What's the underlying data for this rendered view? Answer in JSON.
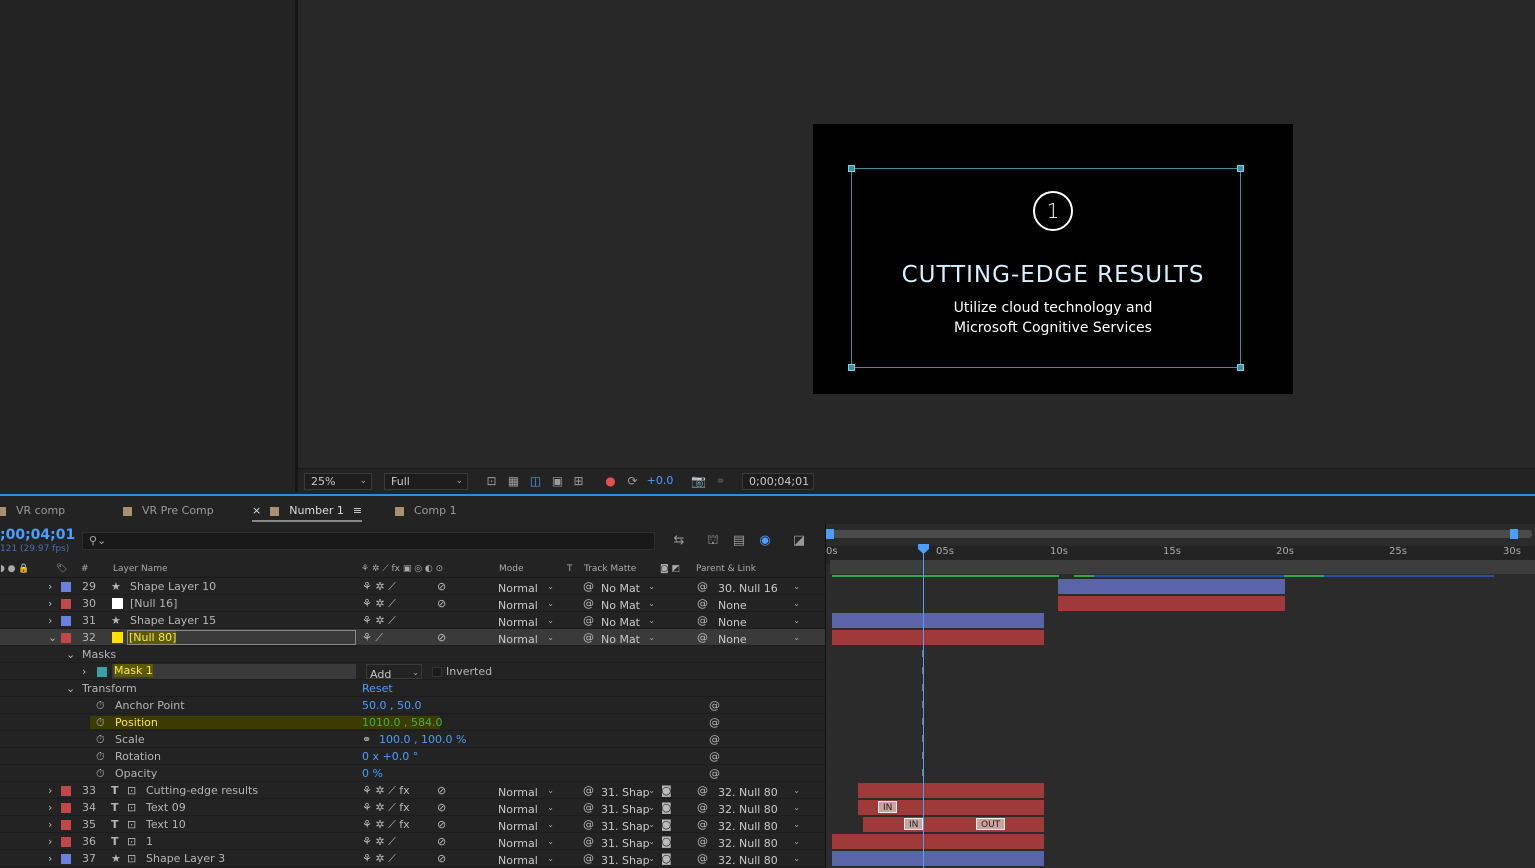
{
  "viewer": {
    "zoom": "25%",
    "resolution": "Full",
    "exposure": "+0.0",
    "timecode": "0;00;04;01"
  },
  "composition_preview": {
    "number": "1",
    "headline": "CUTTING-EDGE RESULTS",
    "sub_line1": "Utilize cloud technology and",
    "sub_line2": "Microsoft Cognitive Services"
  },
  "tabs": [
    {
      "label": "VR comp"
    },
    {
      "label": "VR Pre Comp"
    },
    {
      "label": "Number 1",
      "active": true
    },
    {
      "label": "Comp 1"
    }
  ],
  "timeline": {
    "timecode": ";00;04;01",
    "fps": "121 (29.97 fps)",
    "search_placeholder": "",
    "columns": {
      "num": "#",
      "layer_name": "Layer Name",
      "mode": "Mode",
      "t": "T",
      "track_matte": "Track Matte",
      "parent": "Parent & Link"
    },
    "ruler": [
      "0s",
      "05s",
      "10s",
      "15s",
      "20s",
      "25s",
      "30s"
    ],
    "layers_top": [
      {
        "num": "29",
        "name": "Shape Layer 10",
        "type": "star",
        "color": "#6b7fdc",
        "mode": "Normal",
        "matte": "No Mat",
        "parent": "30. Null 16"
      },
      {
        "num": "30",
        "name": "[Null 16]",
        "type": "null",
        "color": "#c04848",
        "mode": "Normal",
        "matte": "No Mat",
        "parent": "None"
      },
      {
        "num": "31",
        "name": "Shape Layer 15",
        "type": "star",
        "color": "#6b7fdc",
        "mode": "Normal",
        "matte": "No Mat",
        "parent": "None"
      },
      {
        "num": "32",
        "name": "[Null 80]",
        "type": "null-yellow",
        "color": "#c04848",
        "mode": "Normal",
        "matte": "No Mat",
        "parent": "None"
      }
    ],
    "masks_label": "Masks",
    "mask1": {
      "name": "Mask 1",
      "mode": "Add",
      "inverted": "Inverted"
    },
    "transform_label": "Transform",
    "reset_label": "Reset",
    "properties": [
      {
        "name": "Anchor Point",
        "value": "50.0 , 50.0"
      },
      {
        "name": "Position",
        "value": "1010.0 , 584.0"
      },
      {
        "name": "Scale",
        "value": "100.0 , 100.0 %"
      },
      {
        "name": "Rotation",
        "value": "0 x +0.0 °"
      },
      {
        "name": "Opacity",
        "value": "0 %"
      }
    ],
    "layers_bottom": [
      {
        "num": "33",
        "name": "Cutting-edge results",
        "type": "T",
        "color": "#c04848",
        "mode": "Normal",
        "matte": "31. Shap",
        "parent": "32. Null 80"
      },
      {
        "num": "34",
        "name": "Text 09",
        "type": "T",
        "color": "#c04848",
        "mode": "Normal",
        "matte": "31. Shap",
        "parent": "32. Null 80"
      },
      {
        "num": "35",
        "name": "Text 10",
        "type": "T",
        "color": "#c04848",
        "mode": "Normal",
        "matte": "31. Shap",
        "parent": "32. Null 80"
      },
      {
        "num": "36",
        "name": "1",
        "type": "T",
        "color": "#c04848",
        "mode": "Normal",
        "matte": "31. Shap",
        "parent": "32. Null 80"
      },
      {
        "num": "37",
        "name": "Shape Layer 3",
        "type": "star",
        "color": "#6b7fdc",
        "mode": "Normal",
        "matte": "31. Shap",
        "parent": "32. Null 80"
      }
    ],
    "markers": {
      "in": "IN",
      "out": "OUT"
    }
  }
}
